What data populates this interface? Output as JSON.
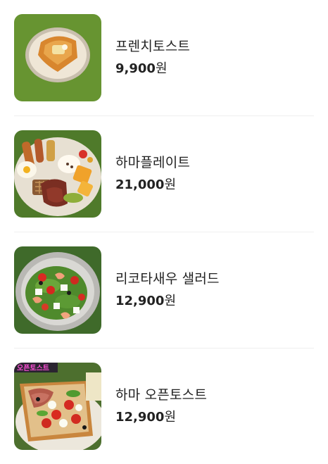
{
  "menu": {
    "items": [
      {
        "name": "프렌치토스트",
        "price": "9,900",
        "currency": "원",
        "image": "french-toast-photo"
      },
      {
        "name": "하마플레이트",
        "price": "21,000",
        "currency": "원",
        "image": "brunch-plate-photo"
      },
      {
        "name": "리코타새우 샐러드",
        "price": "12,900",
        "currency": "원",
        "image": "shrimp-salad-photo"
      },
      {
        "name": "하마 오픈토스트",
        "price": "12,900",
        "currency": "원",
        "image": "open-toast-photo",
        "image_text": "오픈토스트"
      }
    ]
  },
  "colors": {
    "text": "#222222",
    "divider": "#efefef",
    "grass": "#5f8a2e"
  }
}
